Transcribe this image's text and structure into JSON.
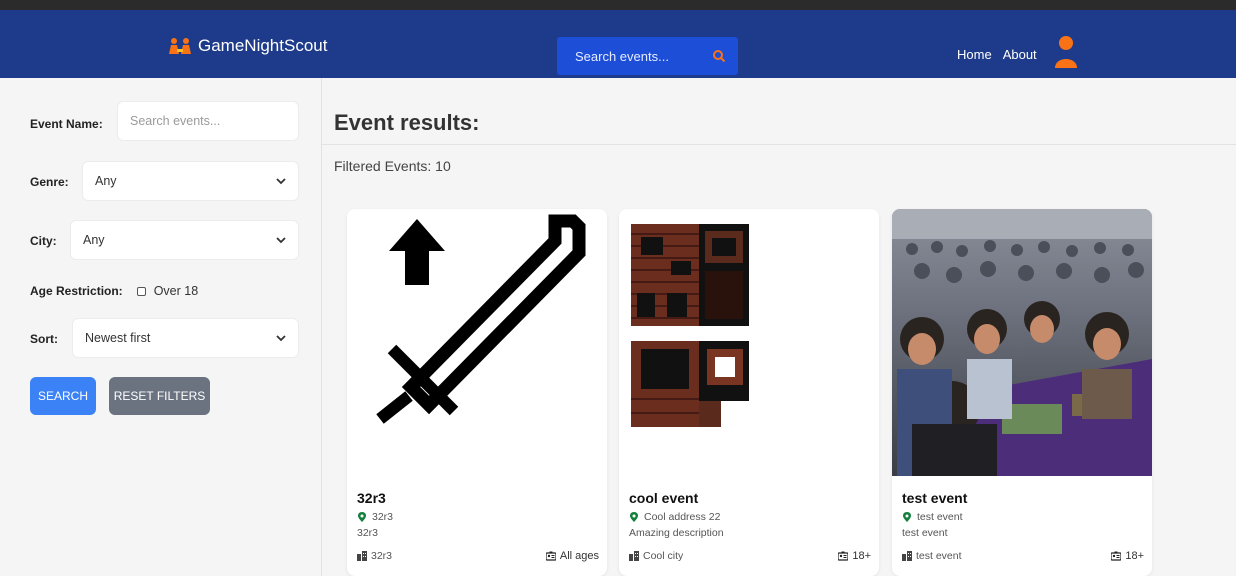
{
  "brand": {
    "name": "GameNightScout"
  },
  "nav": {
    "search_placeholder": "Search events...",
    "links": [
      "Home",
      "About"
    ]
  },
  "colors": {
    "navbar": "#1e3a8a",
    "accent": "#f97316",
    "search_button": "#3b82f6",
    "reset_button": "#6b7280"
  },
  "filters": {
    "event_name": {
      "label": "Event Name:",
      "placeholder": "Search events..."
    },
    "genre": {
      "label": "Genre:",
      "value": "Any"
    },
    "city": {
      "label": "City:",
      "value": "Any"
    },
    "age": {
      "label": "Age Restriction:",
      "option": "Over 18",
      "checked": false
    },
    "sort": {
      "label": "Sort:",
      "value": "Newest first"
    },
    "search_button": "SEARCH",
    "reset_button": "RESET FILTERS"
  },
  "results": {
    "title": "Event results:",
    "filtered_text": "Filtered Events: 10",
    "cards": [
      {
        "image": "sword-arrow-icon",
        "title": "32r3",
        "address": "32r3",
        "description": "32r3",
        "city": "32r3",
        "age": "All ages"
      },
      {
        "image": "pixel-tiles-image",
        "title": "cool event",
        "address": "Cool address 22",
        "description": "Amazing description",
        "city": "Cool city",
        "age": "18+"
      },
      {
        "image": "crowd-photo",
        "title": "test event",
        "address": "test event",
        "description": "test event",
        "city": "test event",
        "age": "18+"
      }
    ]
  }
}
